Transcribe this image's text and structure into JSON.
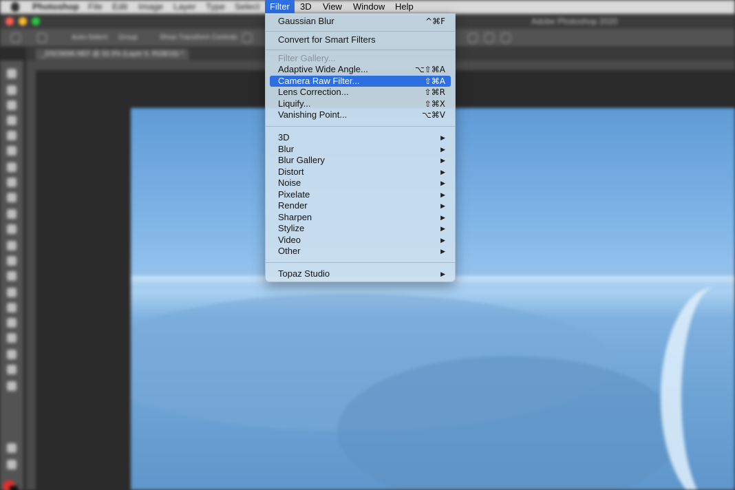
{
  "menubar": {
    "apple_icon": "apple-icon",
    "items": [
      "Photoshop",
      "File",
      "Edit",
      "Image",
      "Layer",
      "Type",
      "Select"
    ],
    "active_menus": {
      "filter": "Filter",
      "threed": "3D",
      "view": "View",
      "window": "Window",
      "help": "Help"
    }
  },
  "window": {
    "title": "Adobe Photoshop 2020",
    "traffic_colors": [
      "#ff5f57",
      "#febc2e",
      "#28c840"
    ]
  },
  "options_bar": {
    "auto_select": "Auto-Select:",
    "group": "Group",
    "show_transform": "Show Transform Controls"
  },
  "document_tab": "_DSC8696.NEF @ 33.3% (Layer 0, RGB/16) *",
  "colors": {
    "accent": "#2d6fe0",
    "foreground_swatch": "#e03030",
    "background_swatch": "#111111"
  },
  "filter_menu": {
    "last_filter": {
      "label": "Gaussian Blur",
      "shortcut": "^⌘F"
    },
    "convert": {
      "label": "Convert for Smart Filters"
    },
    "filter_gallery": {
      "label": "Filter Gallery..."
    },
    "adaptive_wide_angle": {
      "label": "Adaptive Wide Angle...",
      "shortcut": "⌥⇧⌘A"
    },
    "camera_raw": {
      "label": "Camera Raw Filter...",
      "shortcut": "⇧⌘A"
    },
    "lens_correction": {
      "label": "Lens Correction...",
      "shortcut": "⇧⌘R"
    },
    "liquify": {
      "label": "Liquify...",
      "shortcut": "⇧⌘X"
    },
    "vanishing_point": {
      "label": "Vanishing Point...",
      "shortcut": "⌥⌘V"
    },
    "submenus": [
      "3D",
      "Blur",
      "Blur Gallery",
      "Distort",
      "Noise",
      "Pixelate",
      "Render",
      "Sharpen",
      "Stylize",
      "Video",
      "Other"
    ],
    "topaz": {
      "label": "Topaz Studio"
    },
    "submenu_arrow": "▶"
  }
}
